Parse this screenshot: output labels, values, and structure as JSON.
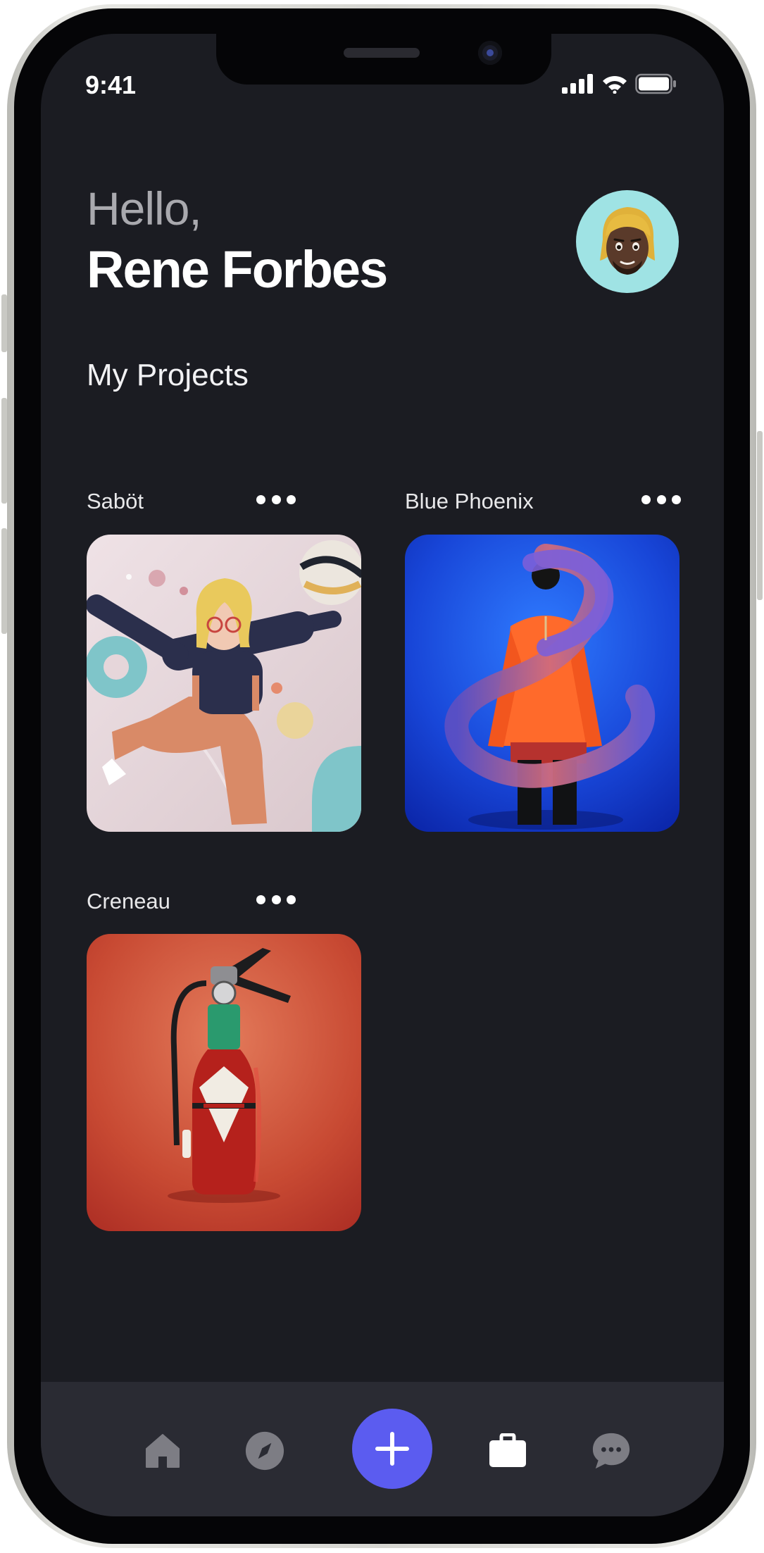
{
  "status_bar": {
    "time": "9:41"
  },
  "header": {
    "greeting": "Hello,",
    "name": "Rene Forbes"
  },
  "section": {
    "title": "My Projects"
  },
  "projects": [
    {
      "name": "Saböt"
    },
    {
      "name": "Blue Phoenix"
    },
    {
      "name": "Creneau"
    }
  ],
  "tab_bar": {
    "items": [
      "home-icon",
      "compass-icon",
      "add-icon",
      "briefcase-icon",
      "chat-icon"
    ],
    "active_color": "#ffffff",
    "inactive_color": "#7d7d84",
    "fab_color": "#5b5cf0"
  },
  "colors": {
    "screen_bg": "#1b1c22",
    "tab_bar_bg": "#2a2b33"
  }
}
